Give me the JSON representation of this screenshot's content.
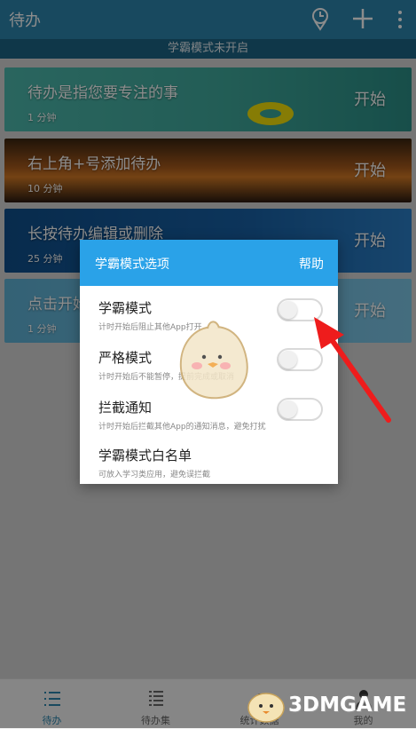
{
  "appbar": {
    "title": "待办",
    "icons": [
      "clock-icon",
      "plus-icon",
      "more-icon"
    ]
  },
  "banner": "学霸模式未开启",
  "tasks": [
    {
      "name": "待办是指您要专注的事",
      "duration": "1 分钟",
      "action": "开始"
    },
    {
      "name": "右上角+号添加待办",
      "duration": "10 分钟",
      "action": "开始"
    },
    {
      "name": "长按待办编辑或删除",
      "duration": "25 分钟",
      "action": "开始"
    },
    {
      "name": "点击开始",
      "duration": "1 分钟",
      "action": "开始"
    }
  ],
  "dialog": {
    "title": "学霸模式选项",
    "help": "帮助",
    "options": [
      {
        "name": "学霸模式",
        "desc": "计时开始后阻止其他App打开",
        "enabled": false
      },
      {
        "name": "严格模式",
        "desc": "计时开始后不能暂停，提前完成或取消",
        "enabled": false
      },
      {
        "name": "拦截通知",
        "desc": "计时开始后拦截其他App的通知消息，避免打扰",
        "enabled": false
      },
      {
        "name": "学霸模式白名单",
        "desc": "可放入学习类应用，避免误拦截"
      }
    ]
  },
  "bottomnav": [
    {
      "label": "待办",
      "icon": "list-icon",
      "active": true
    },
    {
      "label": "待办集",
      "icon": "list-detail-icon",
      "active": false
    },
    {
      "label": "统计数据",
      "icon": "stats-icon",
      "active": false
    },
    {
      "label": "我的",
      "icon": "person-icon",
      "active": false
    }
  ],
  "watermark": "3DMGAME",
  "colors": {
    "primary": "#2d86ad",
    "dialog_header": "#2aa2e8",
    "arrow": "#ee1c1c"
  }
}
